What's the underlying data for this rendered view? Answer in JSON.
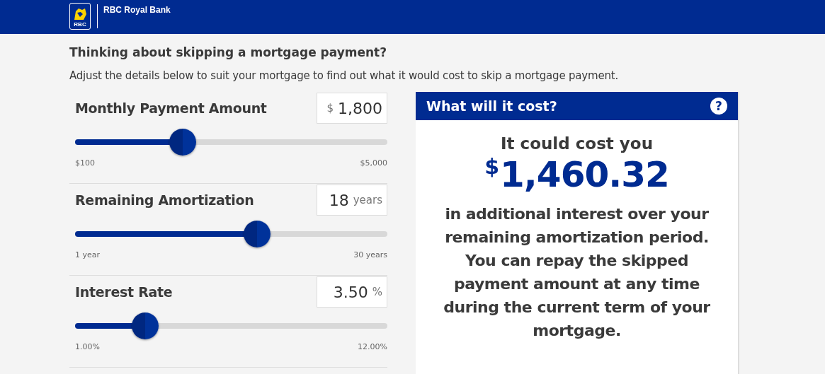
{
  "header": {
    "brand": "RBC Royal Bank",
    "logo_text": "RBC"
  },
  "title": "Thinking about skipping a mortgage payment?",
  "intro": "Adjust the details below to suit your mortgage to find out what it would cost to skip a mortgage payment.",
  "inputs": [
    {
      "label": "Monthly Payment Amount",
      "value": "1,800",
      "unit": "$",
      "kind": "prefix",
      "level": 0.345,
      "min_label": "$100",
      "max_label": "$5,000"
    },
    {
      "label": "Remaining Amortization",
      "value": "18",
      "unit": "years",
      "kind": "suffix",
      "level": 0.583,
      "min_label": "1 year",
      "max_label": "30 years"
    },
    {
      "label": "Interest Rate",
      "value": "3.50",
      "unit": "%",
      "kind": "suffix",
      "level": 0.224,
      "min_label": "1.00%",
      "max_label": "12.00%"
    }
  ],
  "result": {
    "heading": "What will it cost?",
    "help": "?",
    "lead": "It could cost you",
    "currency": "$",
    "amount": "1,460.32",
    "description": "in additional interest over your remaining amortization period. You can repay the skipped payment amount at any time during the current term of your mortgage."
  }
}
